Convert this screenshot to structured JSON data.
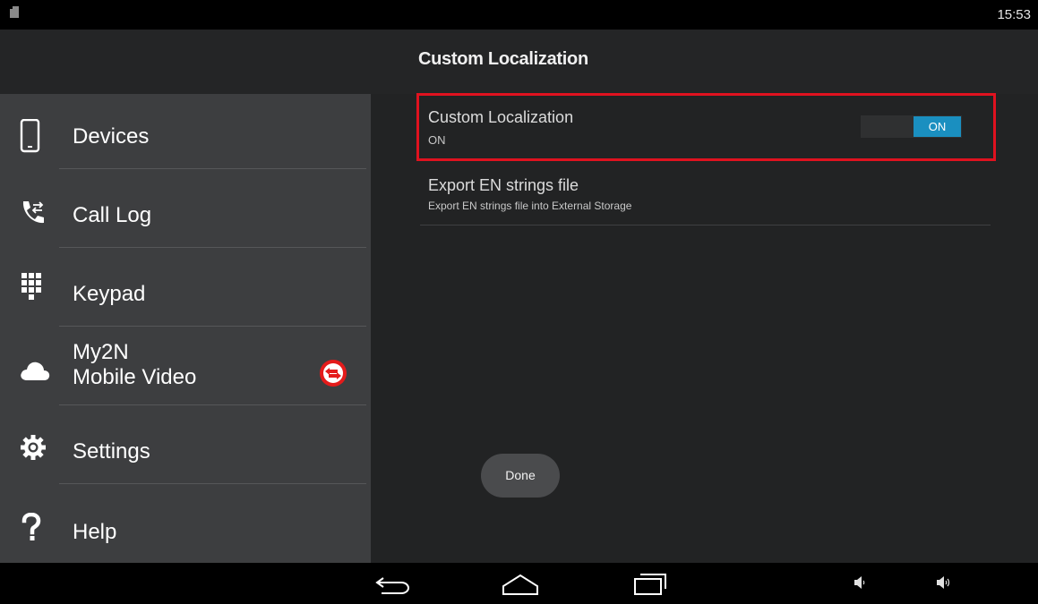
{
  "status_bar": {
    "time": "15:53",
    "sd_icon": "sd-card-icon"
  },
  "header": {
    "title": "Custom Localization"
  },
  "sidebar": {
    "items": [
      {
        "label": "Devices",
        "icon": "phone-icon"
      },
      {
        "label": "Call Log",
        "icon": "call-log-icon"
      },
      {
        "label": "Keypad",
        "icon": "keypad-icon"
      },
      {
        "label_line1": "My2N",
        "label_line2": "Mobile Video",
        "icon": "cloud-icon",
        "badge_icon": "sync-error-icon"
      },
      {
        "label": "Settings",
        "icon": "gear-icon"
      },
      {
        "label": "Help",
        "icon": "question-icon"
      }
    ]
  },
  "preferences": [
    {
      "title": "Custom Localization",
      "summary": "ON",
      "toggle_label": "ON",
      "toggle_state": "on"
    },
    {
      "title": "Export EN strings file",
      "summary": "Export EN strings file into External Storage"
    }
  ],
  "done_button": {
    "label": "Done"
  },
  "nav_bar": {
    "buttons": [
      "back-icon",
      "home-icon",
      "recents-icon"
    ],
    "volume": [
      "volume-down-icon",
      "volume-up-icon"
    ]
  },
  "colors": {
    "accent": "#1a8fc0",
    "highlight_border": "#e0121f",
    "sidebar_bg": "#3d3e40",
    "content_bg": "#222324"
  }
}
